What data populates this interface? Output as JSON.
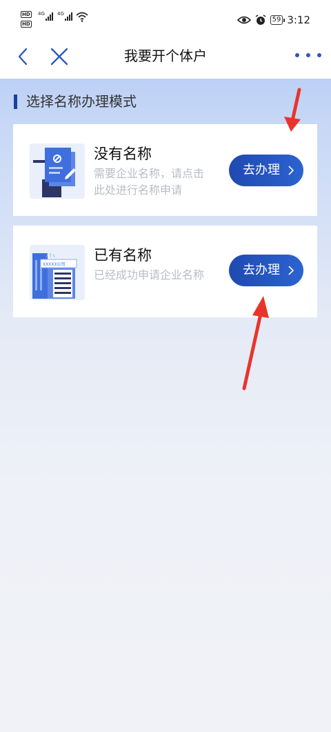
{
  "status_bar": {
    "network_1": "4G",
    "network_2": "4G",
    "battery": "59",
    "time": "3:12"
  },
  "nav": {
    "title": "我要开个体户"
  },
  "section": {
    "title": "选择名称办理模式"
  },
  "cards": [
    {
      "title": "没有名称",
      "desc": "需要企业名称，请点击此处进行名称申请",
      "button": "去办理"
    },
    {
      "title": "已有名称",
      "desc": "已经成功申请企业名称",
      "button": "去办理",
      "icon_text": "XXXXX公司"
    }
  ],
  "colors": {
    "accent": "#1f4ab0",
    "annotation": "#e8352c"
  }
}
